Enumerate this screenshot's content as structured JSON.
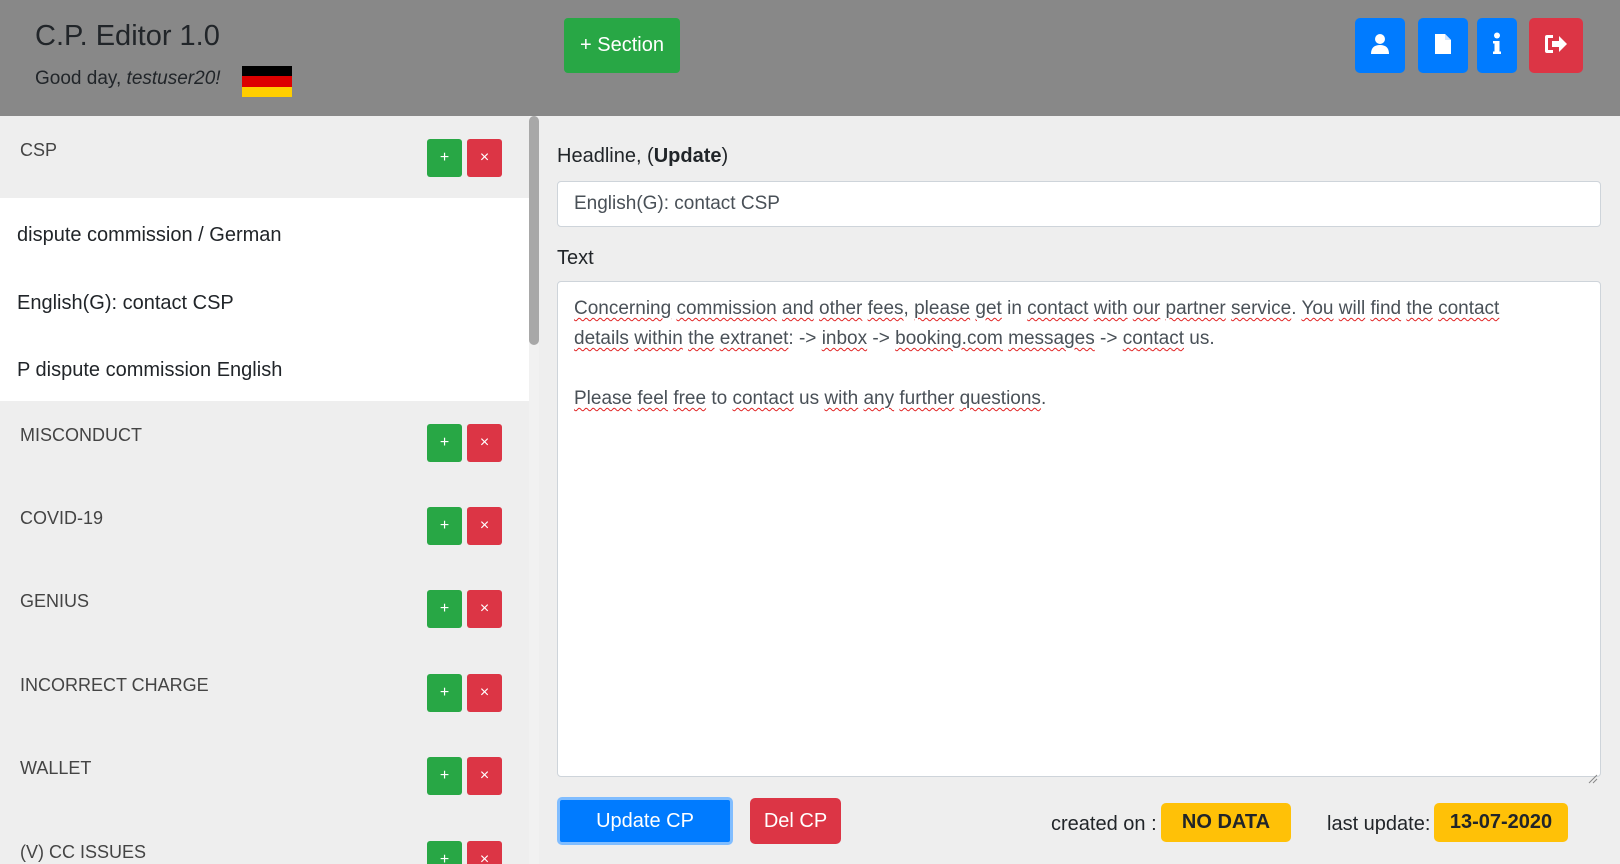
{
  "header": {
    "title": "C.P. Editor 1.0",
    "greeting_prefix": "Good day, ",
    "username": "testuser20!",
    "flag_colors": [
      "#000000",
      "#DD0000",
      "#FFCE00"
    ],
    "add_section_label": "+ Section",
    "icons": [
      "user-icon",
      "document-icon",
      "info-icon",
      "logout-icon"
    ]
  },
  "sidebar": {
    "sections": [
      {
        "name": "CSP",
        "expanded": true,
        "add_label": "+",
        "del_label": "×",
        "items": [
          "dispute commission / German",
          "English(G): contact CSP",
          "P dispute commission English"
        ]
      },
      {
        "name": "MISCONDUCT",
        "add_label": "+",
        "del_label": "×"
      },
      {
        "name": "COVID-19",
        "add_label": "+",
        "del_label": "×"
      },
      {
        "name": "GENIUS",
        "add_label": "+",
        "del_label": "×"
      },
      {
        "name": "INCORRECT CHARGE",
        "add_label": "+",
        "del_label": "×"
      },
      {
        "name": "WALLET",
        "add_label": "+",
        "del_label": "×"
      },
      {
        "name": "(V) CC ISSUES",
        "add_label": "+",
        "del_label": "×"
      }
    ]
  },
  "editor": {
    "headline_label_prefix": "Headline, (",
    "headline_label_bold": "Update",
    "headline_label_suffix": ")",
    "headline_value": "English(G): contact CSP",
    "text_label": "Text",
    "text_line1": "Concerning commission and other fees, please get in contact with our partner service. You will find the contact",
    "text_line2": "details within the extranet: -> inbox -> booking.com messages -> contact us.",
    "text_line3": "Please feel free to contact us with any further questions.",
    "update_button": "Update CP",
    "delete_button": "Del CP",
    "created_label": "created on :",
    "created_value": "NO DATA",
    "updated_label": "last update:",
    "updated_value": "13-07-2020"
  },
  "colors": {
    "header_bg": "#888888",
    "primary": "#007bff",
    "success": "#28a745",
    "danger": "#dc3545",
    "warning": "#ffc107"
  }
}
